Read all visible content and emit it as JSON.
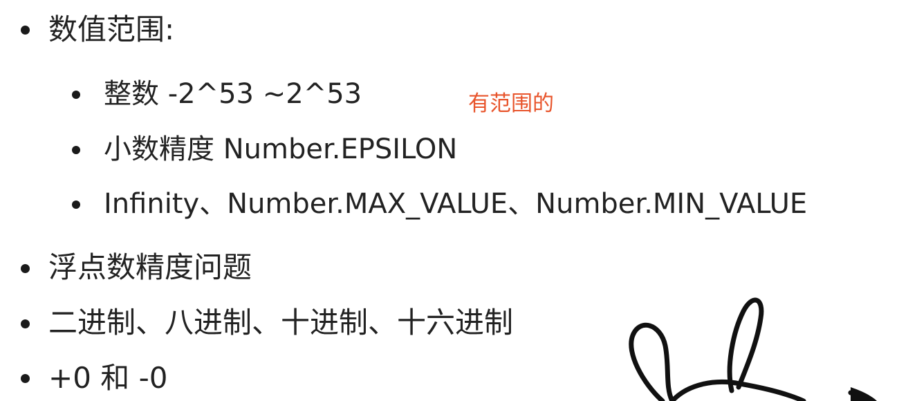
{
  "bullets": [
    {
      "level": 1,
      "text": "数值范围:"
    },
    {
      "level": 2,
      "text": "整数 -2^53 ~2^53"
    },
    {
      "level": 2,
      "text": "小数精度 Number.EPSILON"
    },
    {
      "level": 2,
      "text": "Infinity、Number.MAX_VALUE、Number.MIN_VALUE"
    },
    {
      "level": 1,
      "text": "浮点数精度问题"
    },
    {
      "level": 1,
      "text": "二进制、八进制、十进制、十六进制"
    },
    {
      "level": 1,
      "text": "+0 和 -0"
    }
  ],
  "annotation": {
    "text": "有范围的",
    "color": "#e8542b"
  },
  "doodle": {
    "icon": "rabbit-ears-sketch-icon"
  }
}
